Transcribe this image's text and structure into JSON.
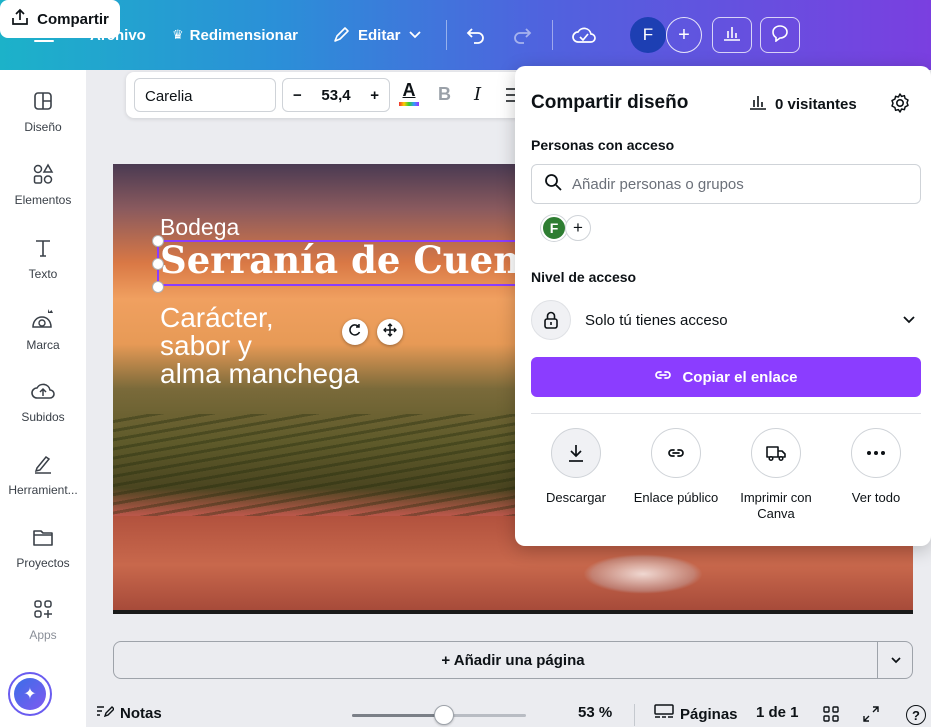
{
  "topbar": {
    "file_label": "Archivo",
    "resize_label": "Redimensionar",
    "edit_label": "Editar",
    "avatar_letter": "F",
    "share_label": "Compartir"
  },
  "sidebar": {
    "items": [
      {
        "label": "Diseño",
        "icon": "layout-icon"
      },
      {
        "label": "Elementos",
        "icon": "shapes-icon"
      },
      {
        "label": "Texto",
        "icon": "text-icon"
      },
      {
        "label": "Marca",
        "icon": "brand-icon"
      },
      {
        "label": "Subidos",
        "icon": "upload-cloud-icon"
      },
      {
        "label": "Herramient...",
        "icon": "pen-tool-icon"
      },
      {
        "label": "Proyectos",
        "icon": "folder-icon"
      },
      {
        "label": "Apps",
        "icon": "apps-icon"
      }
    ]
  },
  "textbar": {
    "font_name": "Carelia",
    "font_size": "53,4",
    "minus": "−",
    "plus": "+",
    "bold": "B",
    "italic": "I"
  },
  "design": {
    "line1": "Bodega",
    "line2": "Serranía de Cuenca",
    "line3": "Carácter,",
    "line4": "sabor y",
    "line5": "alma manchega"
  },
  "share_panel": {
    "title": "Compartir diseño",
    "visitors": "0 visitantes",
    "people_heading": "Personas con acceso",
    "search_placeholder": "Añadir personas o grupos",
    "avatar_letter": "F",
    "access_heading": "Nivel de acceso",
    "access_value": "Solo tú tienes acceso",
    "copy_link_label": "Copiar el enlace",
    "actions": [
      {
        "label": "Descargar",
        "icon": "download-icon"
      },
      {
        "label": "Enlace público",
        "icon": "link-icon"
      },
      {
        "label": "Imprimir con Canva",
        "icon": "truck-icon"
      },
      {
        "label": "Ver todo",
        "icon": "more-icon"
      }
    ]
  },
  "bottom": {
    "add_page_label": "+ Añadir una página",
    "notes_label": "Notas",
    "zoom_value": "53 %",
    "zoom_fraction": 0.53,
    "pages_label": "Páginas",
    "page_counter": "1 de 1",
    "help_label": "?"
  },
  "colors": {
    "accent": "#8b3dff",
    "avatar_blue": "#1d3fb3",
    "avatar_green": "#2e7d32"
  }
}
